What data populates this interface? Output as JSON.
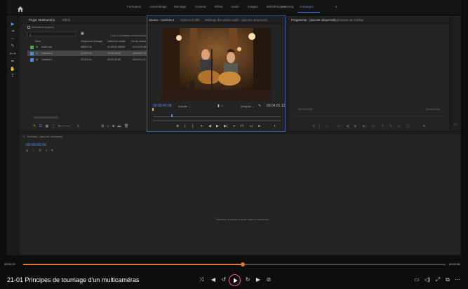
{
  "workspace_tabs": [
    "Formation",
    "Assemblage",
    "Montage",
    "Couleur",
    "Effets",
    "Audio",
    "Images",
    "Bibliothèques",
    "Learning",
    "montages"
  ],
  "workspace_more": "»",
  "project_panel": {
    "tabs": [
      "Projet: Multicaméra",
      "Effets"
    ],
    "project_name": "Multicaméra.prproj",
    "items_count": "1 sur 3 éléments sélectionné(s)",
    "columns": [
      "Nom",
      "Fréquence d'image",
      "Début du média",
      "Fin du média"
    ],
    "rows": [
      {
        "name": "audio.mp",
        "fps": "48000 Hz",
        "start": "01:00:01:28000",
        "end": "01:14:03:364",
        "color": "#3bb34a",
        "selected": false
      },
      {
        "name": "Caméra 2",
        "fps": "23,976 i/s",
        "start": "00:00:00:00",
        "end": "00:04:01:12",
        "color": "#4a8fd8",
        "selected": true
      },
      {
        "name": "Caméra 1",
        "fps": "23,976 i/s",
        "start": "00:00:00:00",
        "end": "00:04:01:11",
        "color": "#4a8fd8",
        "selected": false
      }
    ]
  },
  "source_monitor": {
    "tabs": [
      "Source : Caméra 2",
      "Options d'effet",
      "Mélange des pistes audio : (aucune séquence)"
    ],
    "timecode": "00:00:40:08",
    "fit": "Adapter",
    "quality": "Intégrale",
    "duration": "00:04:01:12"
  },
  "program_monitor": {
    "tabs": [
      "Programme : (aucune séquence)",
      "Explorateur de médias"
    ],
    "timecode_left": "00:00:00:00",
    "timecode_right": "00:00:00:00"
  },
  "timeline": {
    "tab": "Montage : (aucune séquence)",
    "timecode": "00:00:00:00",
    "drop_hint": "Déposez le média ici pour créer la séquence."
  },
  "player": {
    "current_time": "00:00:23",
    "total_time": "00:01:08",
    "progress": 0.52,
    "title": "21-01 Principes de tournage d'un multicaméras",
    "accent": "#e2762b"
  }
}
